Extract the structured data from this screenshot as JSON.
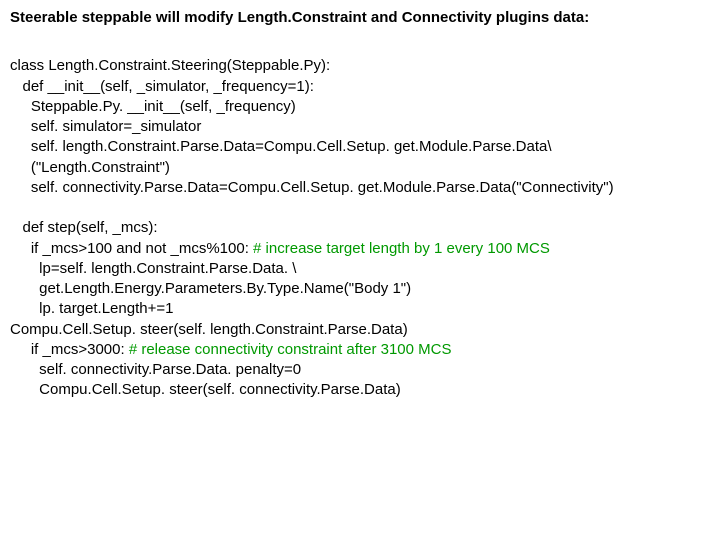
{
  "title": "Steerable steppable will modify Length.Constraint and Connectivity plugins data:",
  "code": {
    "l01": "class Length.Constraint.Steering(Steppable.Py):",
    "l02": "   def __init__(self, _simulator, _frequency=1):",
    "l03": "     Steppable.Py. __init__(self, _frequency)",
    "l04": "     self. simulator=_simulator",
    "l05": "     self. length.Constraint.Parse.Data=Compu.Cell.Setup. get.Module.Parse.Data\\",
    "l06": "     (\"Length.Constraint\")",
    "l07": "     self. connectivity.Parse.Data=Compu.Cell.Setup. get.Module.Parse.Data(\"Connectivity\")",
    "l08": "",
    "l09": "   def step(self, _mcs):",
    "l10a": "     if _mcs>100 and not _mcs%100: ",
    "l10b": "# increase target length by 1 every 100 MCS",
    "l11": "       lp=self. length.Constraint.Parse.Data. \\",
    "l12": "       get.Length.Energy.Parameters.By.Type.Name(\"Body 1\")",
    "l13": "       lp. target.Length+=1",
    "l14": "Compu.Cell.Setup. steer(self. length.Constraint.Parse.Data)",
    "l15a": "     if _mcs>3000: ",
    "l15b": "# release connectivity constraint after 3100 MCS",
    "l16": "       self. connectivity.Parse.Data. penalty=0",
    "l17": "       Compu.Cell.Setup. steer(self. connectivity.Parse.Data)"
  }
}
